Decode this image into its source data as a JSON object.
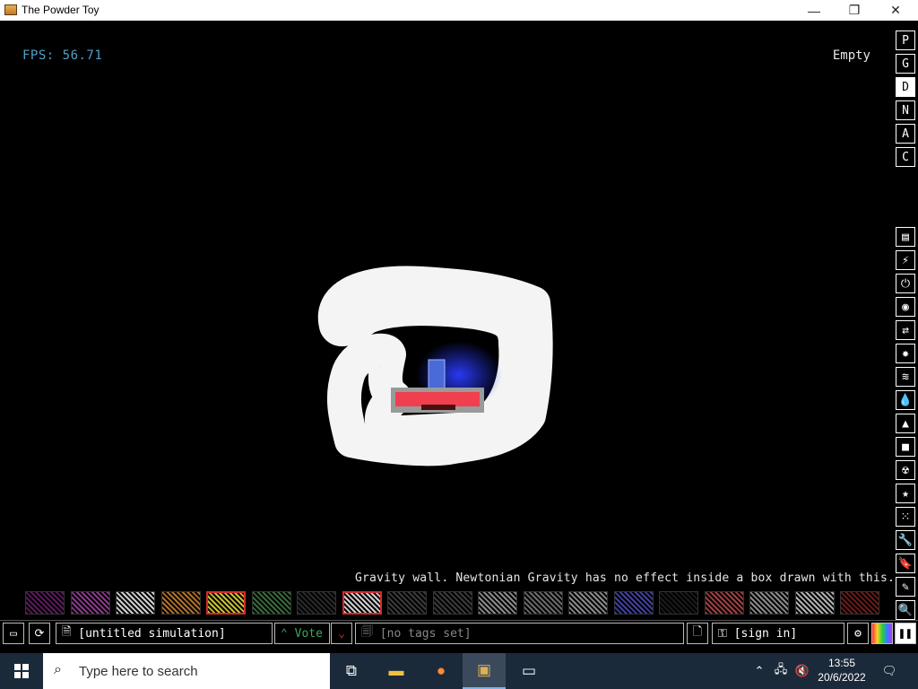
{
  "window": {
    "title": "The Powder Toy",
    "minimize_icon": "—",
    "maximize_icon": "❐",
    "close_icon": "✕"
  },
  "sim": {
    "fps": "FPS: 56.71",
    "hover_label": "Empty"
  },
  "sidebar": {
    "top_buttons": [
      "P",
      "G",
      "D",
      "N",
      "A",
      "C"
    ],
    "categories": [
      {
        "name": "walls-icon",
        "glyph": "▤"
      },
      {
        "name": "electronics-icon",
        "glyph": "⚡"
      },
      {
        "name": "powered-icon",
        "glyph": "⏻"
      },
      {
        "name": "sensors-icon",
        "glyph": "◉"
      },
      {
        "name": "force-icon",
        "glyph": "⇄"
      },
      {
        "name": "explosives-icon",
        "glyph": "✸"
      },
      {
        "name": "gases-icon",
        "glyph": "≋"
      },
      {
        "name": "liquids-icon",
        "glyph": "💧"
      },
      {
        "name": "powders-icon",
        "glyph": "▲"
      },
      {
        "name": "solids-icon",
        "glyph": "■"
      },
      {
        "name": "radioactive-icon",
        "glyph": "☢"
      },
      {
        "name": "special-icon",
        "glyph": "★"
      },
      {
        "name": "life-icon",
        "glyph": "⁙"
      },
      {
        "name": "tools-icon",
        "glyph": "🔧"
      },
      {
        "name": "favorites-icon",
        "glyph": "🔖"
      },
      {
        "name": "decoration-icon",
        "glyph": "✎"
      },
      {
        "name": "search-icon",
        "glyph": "🔍"
      }
    ]
  },
  "toolbar": {
    "tooltip": "Gravity wall. Newtonian Gravity has no effect inside a box drawn with this.",
    "colors": [
      "#5a1a5a",
      "#8a3a8a",
      "#cfcfcf",
      "#b0702a",
      "#c8c030",
      "#3a6a3a",
      "#2a2a2a",
      "#cfcfcf",
      "#3a3a3a",
      "#3a3a3a",
      "#8a8a8a",
      "#6a6a6a",
      "#8a8a8a",
      "#4040a0",
      "#1a1a1a",
      "#a04040",
      "#8a8a8a",
      "#b0b0b0",
      "#6a1a1a"
    ]
  },
  "bottombar": {
    "open_icon": "▭",
    "reload_icon": "⟳",
    "save_label": "[untitled simulation]",
    "vote_label": "Vote",
    "tags_label": "[no tags set]",
    "login_label": "[sign in]",
    "new_icon": "🗋",
    "settings_icon": "⚙",
    "pause_icon": "❚❚"
  },
  "taskbar": {
    "search_placeholder": "Type here to search",
    "time": "13:55",
    "date": "20/6/2022"
  }
}
